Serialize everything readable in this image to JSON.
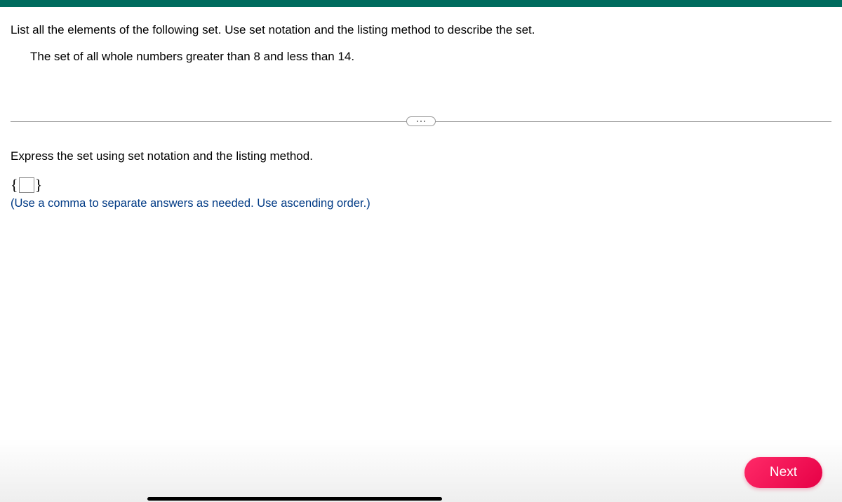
{
  "question": {
    "prompt": "List all the elements of the following set. Use set notation and the listing method to describe the set.",
    "detail": "The set of all whole numbers greater than 8 and less than 14."
  },
  "answer": {
    "prompt": "Express the set using set notation and the listing method.",
    "brace_open": "{",
    "brace_close": "}",
    "input_value": "",
    "hint": "(Use a comma to separate answers as needed. Use ascending order.)"
  },
  "buttons": {
    "next": "Next"
  }
}
